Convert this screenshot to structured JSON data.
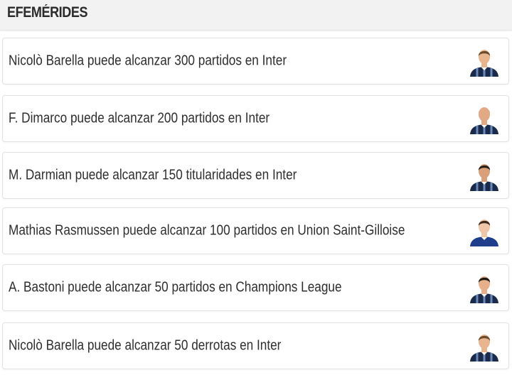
{
  "section": {
    "title": "EFEMÉRIDES"
  },
  "items": [
    {
      "text": "Nicolò Barella puede alcanzar 300 partidos en Inter",
      "avatar_icon": "player-photo-icon",
      "skin": "#e8b58f",
      "hair": "#6b4a2b",
      "shirt": "#1c2a4a",
      "stripe": "#7da3d8"
    },
    {
      "text": "F. Dimarco puede alcanzar 200 partidos en Inter",
      "avatar_icon": "player-photo-icon",
      "skin": "#e2a985",
      "hair": "#e2a985",
      "shirt": "#1c2a4a",
      "stripe": "#7da3d8"
    },
    {
      "text": "M. Darmian puede alcanzar 150 titularidades en Inter",
      "avatar_icon": "player-photo-icon",
      "skin": "#d9a07a",
      "hair": "#2a1e16",
      "shirt": "#1c2a4a",
      "stripe": "#7da3d8"
    },
    {
      "text": "Mathias Rasmussen puede alcanzar 100 partidos en Union Saint-Gilloise",
      "avatar_icon": "player-photo-icon",
      "skin": "#efc6a8",
      "hair": "#3a2a1c",
      "shirt": "#1e3d8a",
      "stripe": "#1e3d8a"
    },
    {
      "text": "A. Bastoni puede alcanzar 50 partidos en Champions League",
      "avatar_icon": "player-photo-icon",
      "skin": "#e6b08c",
      "hair": "#1d1712",
      "shirt": "#1c2a4a",
      "stripe": "#7da3d8"
    },
    {
      "text": "Nicolò Barella puede alcanzar 50 derrotas en Inter",
      "avatar_icon": "player-photo-icon",
      "skin": "#e8b58f",
      "hair": "#6b4a2b",
      "shirt": "#1c2a4a",
      "stripe": "#7da3d8"
    }
  ]
}
